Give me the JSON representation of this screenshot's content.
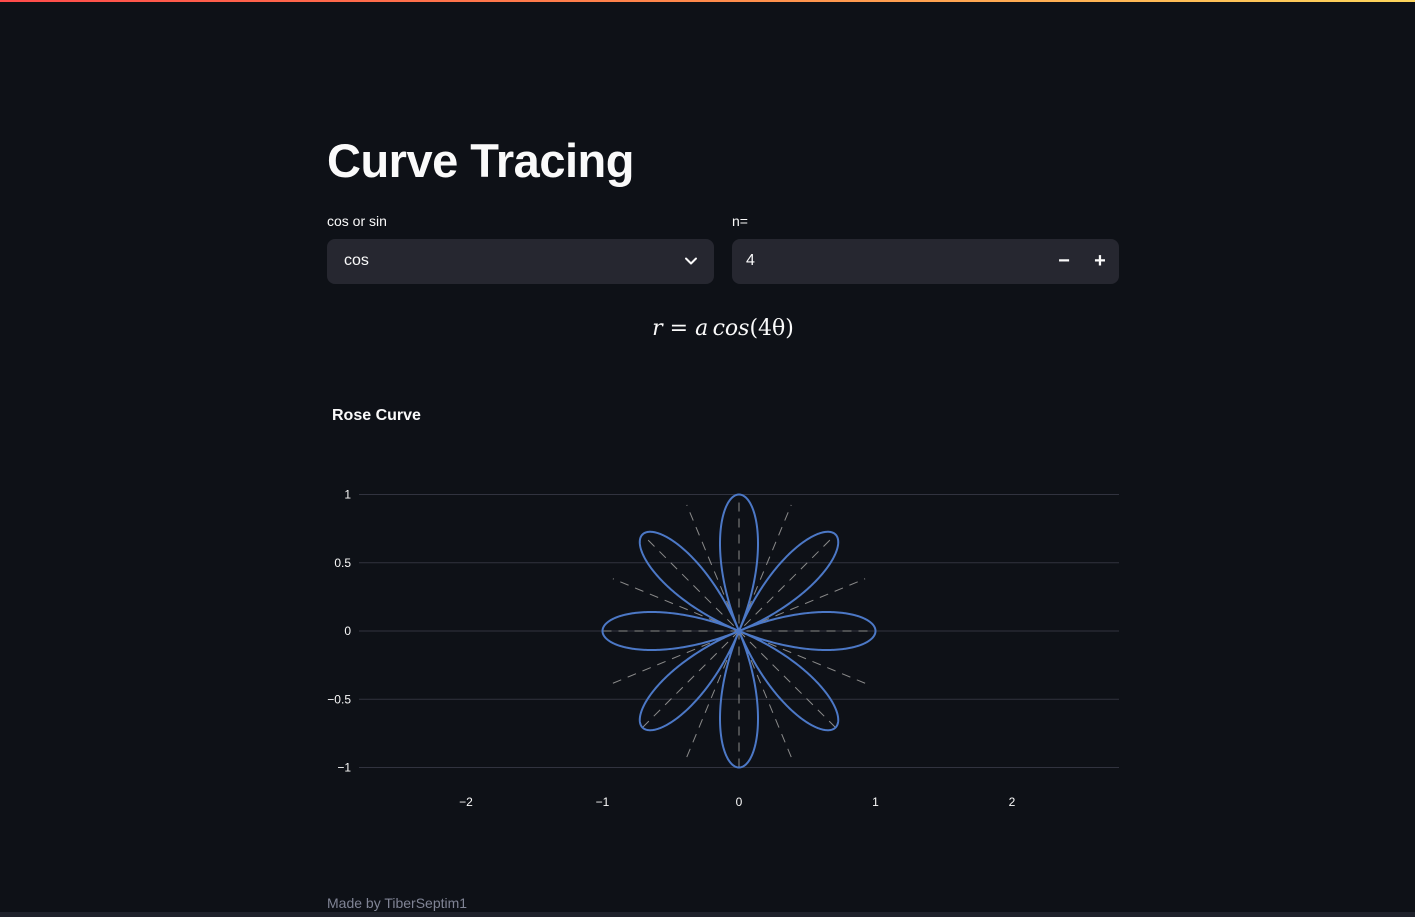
{
  "page": {
    "title": "Curve Tracing",
    "footer": "Made by TiberSeptim1"
  },
  "controls": {
    "select_label": "cos or sin",
    "select_value": "cos",
    "number_label": "n=",
    "number_value": "4",
    "minus_label": "−",
    "plus_label": "+"
  },
  "formula": {
    "lhs": "r",
    "eq": " = ",
    "a": "a",
    "fn": "cos",
    "arg": "(4θ)"
  },
  "colors": {
    "background": "#0e1117",
    "input_bg": "#262730",
    "curve": "#4c78c6",
    "dashes": "#8a8a8a"
  },
  "chart_data": {
    "type": "line",
    "title": "Rose Curve",
    "equation": "r = cos(4θ)",
    "n": 4,
    "a": 1,
    "series": [
      {
        "description_points": "r = cos(4θ), θ from 0 to 2π, 8 petals of length 1"
      }
    ],
    "xlim": [
      -2.8,
      2.8
    ],
    "ylim": [
      -1.1,
      1.1
    ],
    "x_ticks": [
      "−2",
      "−1",
      "0",
      "1",
      "2"
    ],
    "y_ticks": [
      "1",
      "0.5",
      "0",
      "−0.5",
      "−1"
    ],
    "x_tick_values": [
      -2,
      -1,
      0,
      1,
      2
    ],
    "y_tick_values": [
      1,
      0.5,
      0,
      -0.5,
      -1
    ],
    "radial_line_angles_deg": [
      0,
      22.5,
      45,
      67.5,
      90,
      112.5,
      135,
      157.5
    ],
    "grid": "horizontal"
  }
}
